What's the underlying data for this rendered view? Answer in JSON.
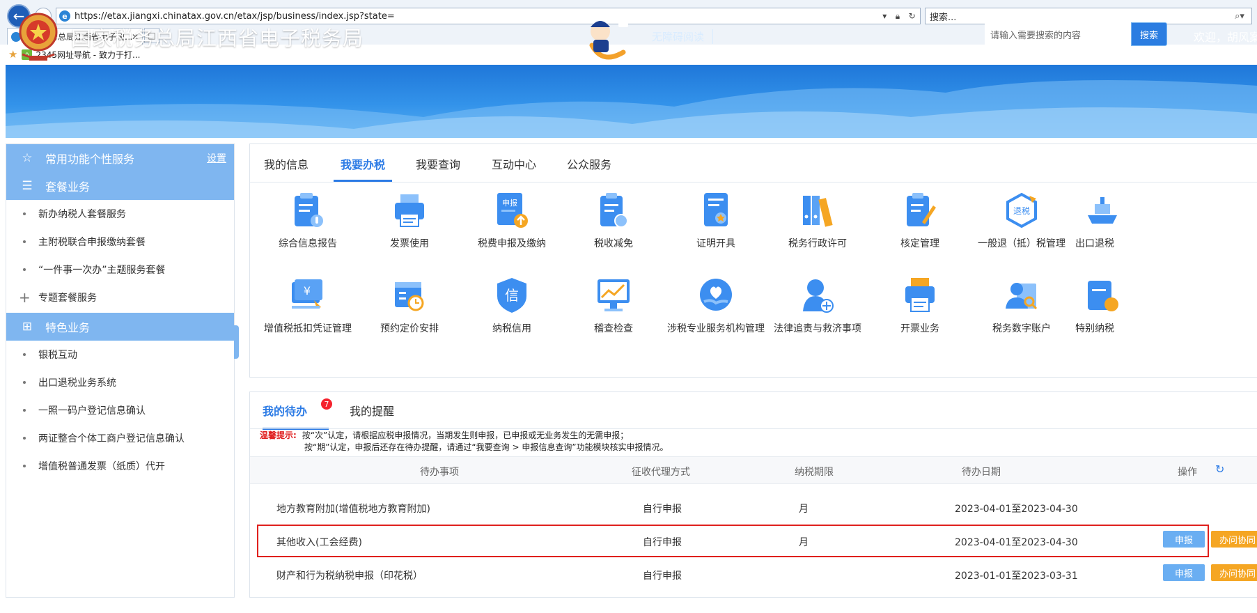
{
  "browser": {
    "url": "https://etax.jiangxi.chinatax.gov.cn/etax/jsp/business/index.jsp?state=",
    "search_placeholder": "搜索...",
    "tab_title": "国家税务总局江西省电子税...",
    "favorite": "2345网址导航 - 致力于打..."
  },
  "banner": {
    "site_title": "国家税务总局江西省电子税务局",
    "accessibility": "无障碍阅读",
    "search_placeholder": "请输入需要搜索的内容",
    "search_button": "搜索",
    "welcome": "欢迎，胡风案"
  },
  "sidebar": {
    "common_header": "常用功能个性服务",
    "settings": "设置",
    "package_header": "套餐业务",
    "package_items": [
      "新办纳税人套餐服务",
      "主附税联合申报缴纳套餐",
      "“一件事一次办”主题服务套餐"
    ],
    "special_topic": "专题套餐服务",
    "featured_header": "特色业务",
    "featured_items": [
      "银税互动",
      "出口退税业务系统",
      "一照一码户登记信息确认",
      "两证整合个体工商户登记信息确认",
      "增值税普通发票（纸质）代开"
    ]
  },
  "main_tabs": [
    "我的信息",
    "我要办税",
    "我要查询",
    "互动中心",
    "公众服务"
  ],
  "functions_row1": [
    "综合信息报告",
    "发票使用",
    "税费申报及缴纳",
    "税收减免",
    "证明开具",
    "税务行政许可",
    "核定管理",
    "一般退（抵）税管理",
    "出口退税"
  ],
  "functions_row2": [
    "增值税抵扣凭证管理",
    "预约定价安排",
    "纳税信用",
    "稽查检查",
    "涉税专业服务机构管理",
    "法律追责与救济事项",
    "开票业务",
    "税务数字账户",
    "特别纳税"
  ],
  "icon_text": {
    "declare": "申报",
    "credit": "信",
    "refund": "退税",
    "yuan": "¥"
  },
  "todo": {
    "tab_todo": "我的待办",
    "badge": "7",
    "tab_reminder": "我的提醒",
    "tip_label": "温馨提示:",
    "tip_line1": "按“次”认定，请根据应税申报情况，当期发生则申报，已申报或无业务发生的无需申报；",
    "tip_line2": "按“期”认定，申报后还存在待办提醒，请通过“我要查询 > 申报信息查询”功能模块核实申报情况。",
    "columns": [
      "待办事项",
      "征收代理方式",
      "纳税期限",
      "待办日期",
      "操作"
    ],
    "rows": [
      {
        "item": "地方教育附加(增值税地方教育附加)",
        "method": "自行申报",
        "period": "月",
        "date": "2023-04-01至2023-04-30",
        "btn1": "",
        "btn2": ""
      },
      {
        "item": "其他收入(工会经费)",
        "method": "自行申报",
        "period": "月",
        "date": "2023-04-01至2023-04-30",
        "btn1": "申报",
        "btn2": "办问协同"
      },
      {
        "item": "财产和行为税纳税申报（印花税）",
        "method": "自行申报",
        "period": "",
        "date": "2023-01-01至2023-03-31",
        "btn1": "申报",
        "btn2": "办问协同"
      }
    ]
  },
  "colors": {
    "accent": "#2c7be5",
    "sidebar_header": "#7fb6f0",
    "warning_button": "#f5a623",
    "highlight": "#e0201d"
  }
}
